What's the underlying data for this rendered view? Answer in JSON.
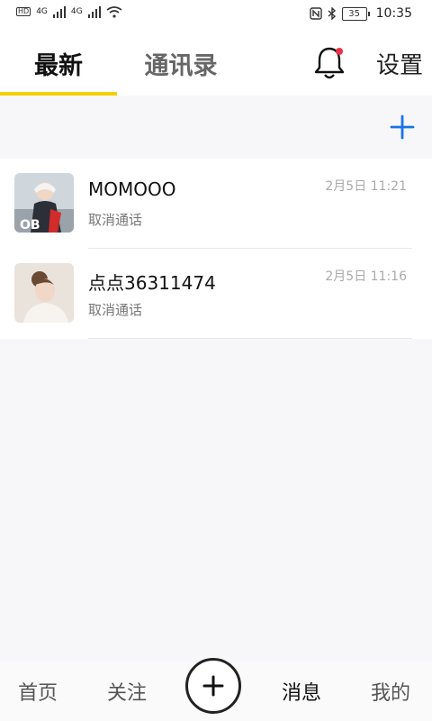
{
  "status_bar": {
    "network_1": "4G",
    "network_2": "4G",
    "battery": "35",
    "time": "10:35",
    "icons": [
      "hd-icon",
      "signal-icon",
      "wifi-icon",
      "nfc-icon",
      "bluetooth-icon",
      "battery-icon"
    ]
  },
  "header": {
    "tab_latest": "最新",
    "tab_contacts": "通讯录",
    "settings": "设置",
    "accent_color": "#f5d000",
    "notification_dot_color": "#e8334a"
  },
  "calls": [
    {
      "name": "MOMOOO",
      "status": "取消通话",
      "time": "2月5日 11:21"
    },
    {
      "name": "点点36311474",
      "status": "取消通话",
      "time": "2月5日 11:16"
    }
  ],
  "add_button": {
    "icon": "plus-icon",
    "color": "#1a73e8"
  },
  "bottom_nav": {
    "home": "首页",
    "follow": "关注",
    "messages": "消息",
    "me": "我的",
    "active": "消息"
  }
}
